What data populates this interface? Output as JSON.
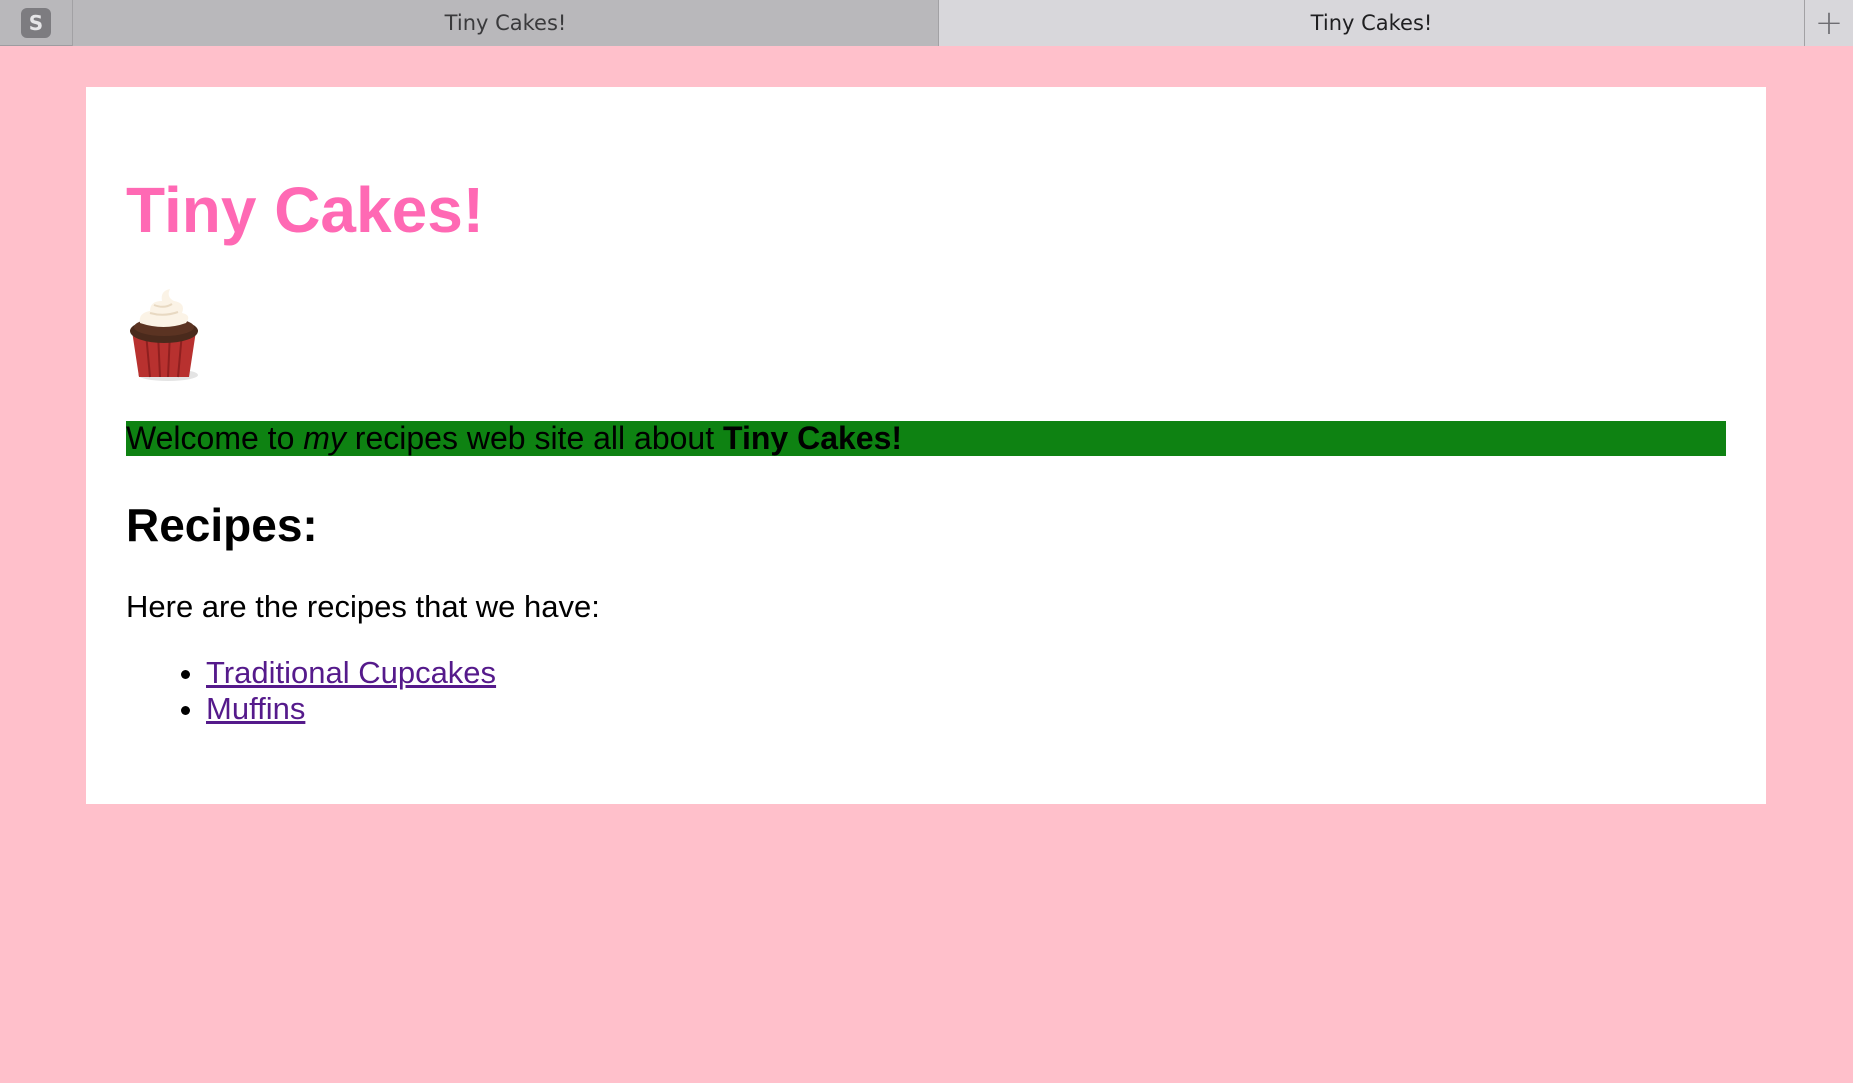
{
  "browser": {
    "app_icon_letter": "S",
    "tabs": [
      {
        "label": "Tiny Cakes!",
        "active": false
      },
      {
        "label": "Tiny Cakes!",
        "active": true
      }
    ],
    "new_tab_symbol": "+"
  },
  "page": {
    "background_color": "#ffc0cb",
    "title": "Tiny Cakes!",
    "title_color": "#ff69b4",
    "image": "cupcake-image",
    "welcome": {
      "prefix": "Welcome to ",
      "emphasis": "my",
      "middle": " recipes web site all about ",
      "strong": "Tiny Cakes!",
      "highlight_color": "#0e8212"
    },
    "recipes_heading": "Recipes:",
    "intro": "Here are the recipes that we have:",
    "recipes": [
      {
        "label": "Traditional Cupcakes"
      },
      {
        "label": "Muffins"
      }
    ],
    "link_color": "#551a8b"
  }
}
